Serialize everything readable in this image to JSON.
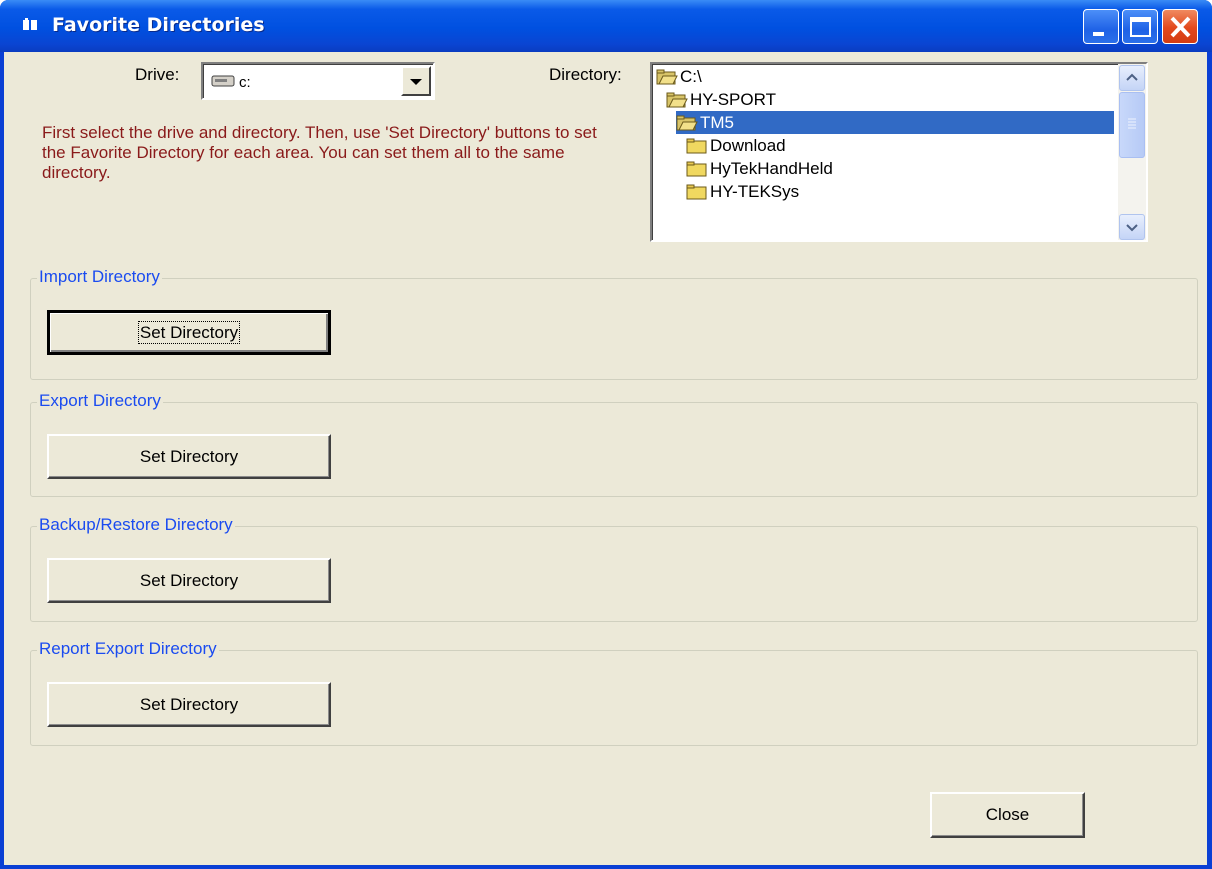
{
  "window": {
    "title": "Favorite Directories"
  },
  "drive": {
    "label": "Drive:",
    "value": "c:"
  },
  "directory": {
    "label": "Directory:",
    "items": [
      {
        "name": "C:\\",
        "icon": "open-folder-icon",
        "selected": false
      },
      {
        "name": "HY-SPORT",
        "icon": "open-folder-icon",
        "selected": false
      },
      {
        "name": "TM5",
        "icon": "open-folder-icon",
        "selected": true
      },
      {
        "name": "Download",
        "icon": "folder-icon",
        "selected": false
      },
      {
        "name": "HyTekHandHeld",
        "icon": "folder-icon",
        "selected": false
      },
      {
        "name": "HY-TEKSys",
        "icon": "folder-icon",
        "selected": false
      }
    ]
  },
  "instructions": "First select the drive and directory. Then, use 'Set Directory' buttons to set the Favorite Directory for each area.  You can set them all to the same directory.",
  "groups": [
    {
      "title": "Import Directory",
      "button": "Set Directory"
    },
    {
      "title": "Export Directory",
      "button": "Set Directory"
    },
    {
      "title": "Backup/Restore Directory",
      "button": "Set Directory"
    },
    {
      "title": "Report Export Directory",
      "button": "Set Directory"
    }
  ],
  "close_label": "Close",
  "colors": {
    "titlebar": "#0050e0",
    "client": "#ece9d8",
    "info_text": "#8a1a1a",
    "group_title": "#1a4bf0",
    "selection": "#316ac5"
  }
}
